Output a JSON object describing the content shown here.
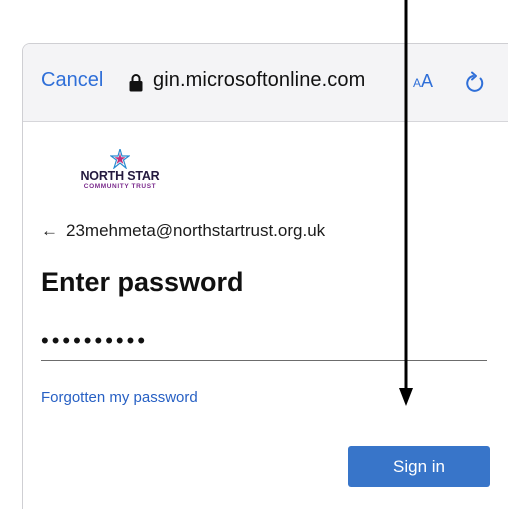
{
  "toolbar": {
    "cancel_label": "Cancel",
    "url": "gin.microsoftonline.com",
    "text_size_small": "A",
    "text_size_large": "A",
    "lock_icon": "lock-icon",
    "reload_icon": "reload-icon"
  },
  "logo": {
    "name": "NORTH STAR",
    "subtitle": "COMMUNITY TRUST"
  },
  "identity": {
    "back_arrow": "←",
    "email": "23mehmeta@northstartrust.org.uk"
  },
  "heading": "Enter password",
  "password_value": "••••••••••",
  "forgot_link": "Forgotten my password",
  "signin_label": "Sign in",
  "colors": {
    "link": "#2f6fd8",
    "button": "#3875c9"
  }
}
